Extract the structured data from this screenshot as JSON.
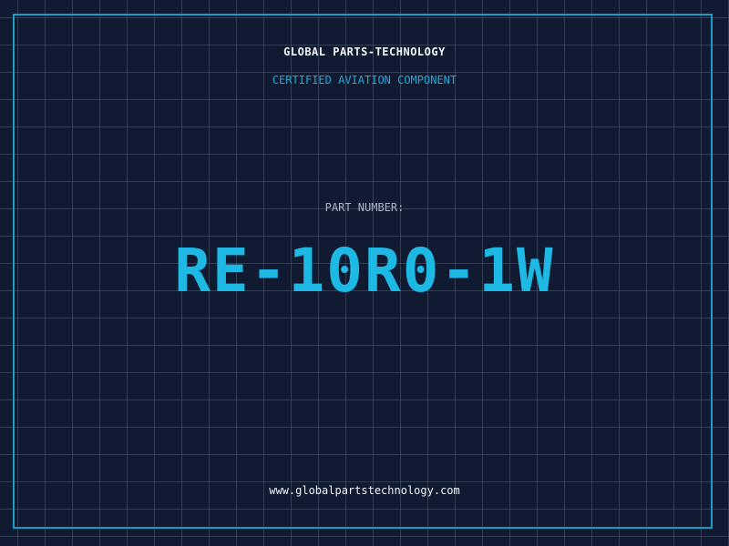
{
  "company_name": "GLOBAL PARTS-TECHNOLOGY",
  "subtitle": "CERTIFIED AVIATION COMPONENT",
  "part_number_label": "PART NUMBER:",
  "part_number": "RE-10R0-1W",
  "website": "www.globalpartstechnology.com",
  "colors": {
    "background": "#101a30",
    "grid": "#1e6e96",
    "frame": "#1a9cc6",
    "accent": "#1db8e4",
    "label": "#a9b4c6",
    "text": "#eef3f8"
  }
}
